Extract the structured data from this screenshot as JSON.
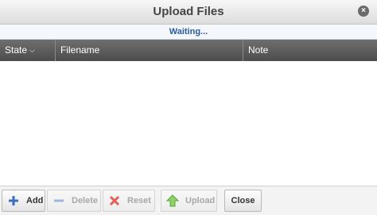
{
  "dialog": {
    "title": "Upload Files",
    "status": "Waiting...",
    "close_icon_glyph": "×"
  },
  "grid": {
    "columns": [
      "State",
      "Filename",
      "Note"
    ],
    "sort_glyph": "⌵",
    "rows": []
  },
  "toolbar": {
    "add_label": "Add",
    "delete_label": "Delete",
    "reset_label": "Reset",
    "upload_label": "Upload",
    "close_label": "Close"
  },
  "icons": {
    "add": "plus-icon",
    "delete": "minus-icon",
    "reset": "x-icon",
    "upload": "up-arrow-icon"
  },
  "colors": {
    "add_icon": "#3a6fc4",
    "reset_icon": "#e0605a",
    "upload_icon": "#6fbf4a",
    "status_text": "#2a5d9f"
  }
}
